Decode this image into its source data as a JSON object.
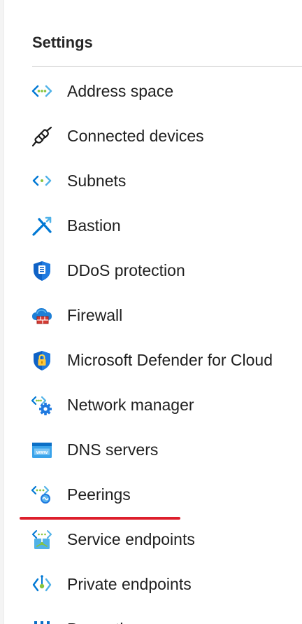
{
  "section": {
    "title": "Settings"
  },
  "menu": {
    "items": [
      {
        "label": "Address space",
        "icon": "address-space-icon"
      },
      {
        "label": "Connected devices",
        "icon": "plug-icon"
      },
      {
        "label": "Subnets",
        "icon": "subnets-icon"
      },
      {
        "label": "Bastion",
        "icon": "bastion-icon"
      },
      {
        "label": "DDoS protection",
        "icon": "ddos-shield-icon"
      },
      {
        "label": "Firewall",
        "icon": "firewall-cloud-icon"
      },
      {
        "label": "Microsoft Defender for Cloud",
        "icon": "defender-shield-icon"
      },
      {
        "label": "Network manager",
        "icon": "network-manager-icon"
      },
      {
        "label": "DNS servers",
        "icon": "dns-www-icon"
      },
      {
        "label": "Peerings",
        "icon": "peerings-icon"
      },
      {
        "label": "Service endpoints",
        "icon": "service-endpoints-icon"
      },
      {
        "label": "Private endpoints",
        "icon": "private-endpoints-icon"
      },
      {
        "label": "Properties",
        "icon": "properties-bars-icon"
      }
    ]
  },
  "colors": {
    "azure_blue": "#0078d4",
    "light_blue": "#50b2e8",
    "green_dot": "#86c440",
    "annotation_red": "#dd1f2c"
  }
}
